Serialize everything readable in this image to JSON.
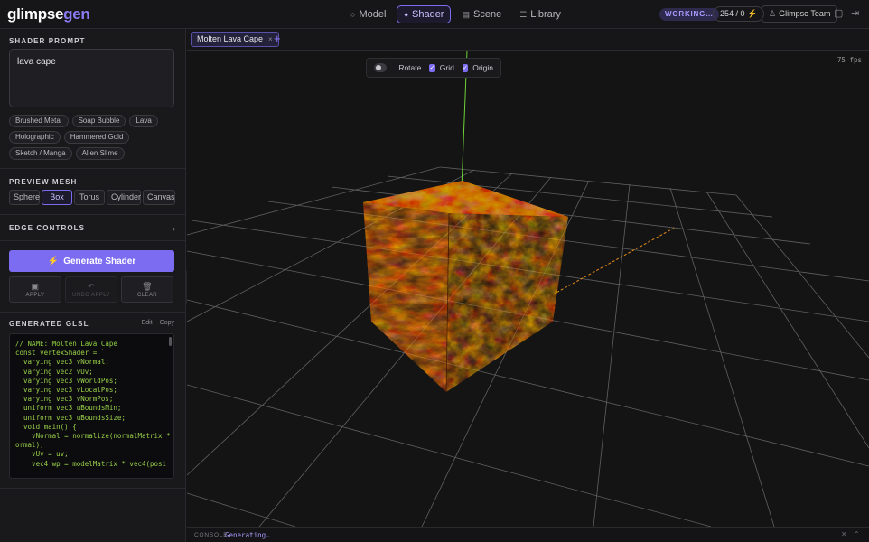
{
  "app": {
    "logo_part1": "glimpse",
    "logo_part2": "gen"
  },
  "nav": [
    {
      "label": "Model",
      "icon": "○"
    },
    {
      "label": "Shader",
      "icon": "♦"
    },
    {
      "label": "Scene",
      "icon": "▤"
    },
    {
      "label": "Library",
      "icon": "☰"
    }
  ],
  "header": {
    "status": "WORKING…",
    "credits": "254 / 0",
    "team": "Glimpse Team"
  },
  "sidebar": {
    "prompt_title": "SHADER PROMPT",
    "prompt_value": "lava cape",
    "presets": [
      "Brushed Metal",
      "Soap Bubble",
      "Lava",
      "Holographic",
      "Hammered Gold",
      "Sketch / Manga",
      "Alien Slime"
    ],
    "mesh_title": "PREVIEW MESH",
    "meshes": [
      "Sphere",
      "Box",
      "Torus",
      "Cylinder",
      "Canvas"
    ],
    "edge_title": "EDGE CONTROLS",
    "generate_label": "Generate Shader",
    "actions": {
      "apply": "APPLY",
      "undo": "UNDO APPLY",
      "clear": "CLEAR"
    },
    "glsl_title": "GENERATED GLSL",
    "edit": "Edit",
    "copy": "Copy",
    "code": [
      "// NAME: Molten Lava Cape",
      "const vertexShader = `",
      "  varying vec3 vNormal;",
      "  varying vec2 vUv;",
      "  varying vec3 vWorldPos;",
      "  varying vec3 vLocalPos;",
      "  varying vec3 vNormPos;",
      "",
      "  uniform vec3 uBoundsMin;",
      "  uniform vec3 uBoundsSize;",
      "",
      "  void main() {",
      "    vNormal = normalize(normalMatrix * n",
      "ormal);",
      "    vUv = uv;",
      "    vec4 wp = modelMatrix * vec4(posi"
    ]
  },
  "tabs": {
    "active": "Molten Lava Cape",
    "close": "×",
    "add": "+"
  },
  "viewport": {
    "fps": "75 fps",
    "rotate": "Rotate",
    "grid": "Grid",
    "origin": "Origin",
    "rotate_on": false,
    "grid_on": true,
    "origin_on": true
  },
  "console": {
    "label": "CONSOLE",
    "message": "Generating…"
  },
  "colors": {
    "accent": "#7c6cf2",
    "lava_hot": "#ff7a10",
    "lava_dark": "#7a0e02"
  }
}
